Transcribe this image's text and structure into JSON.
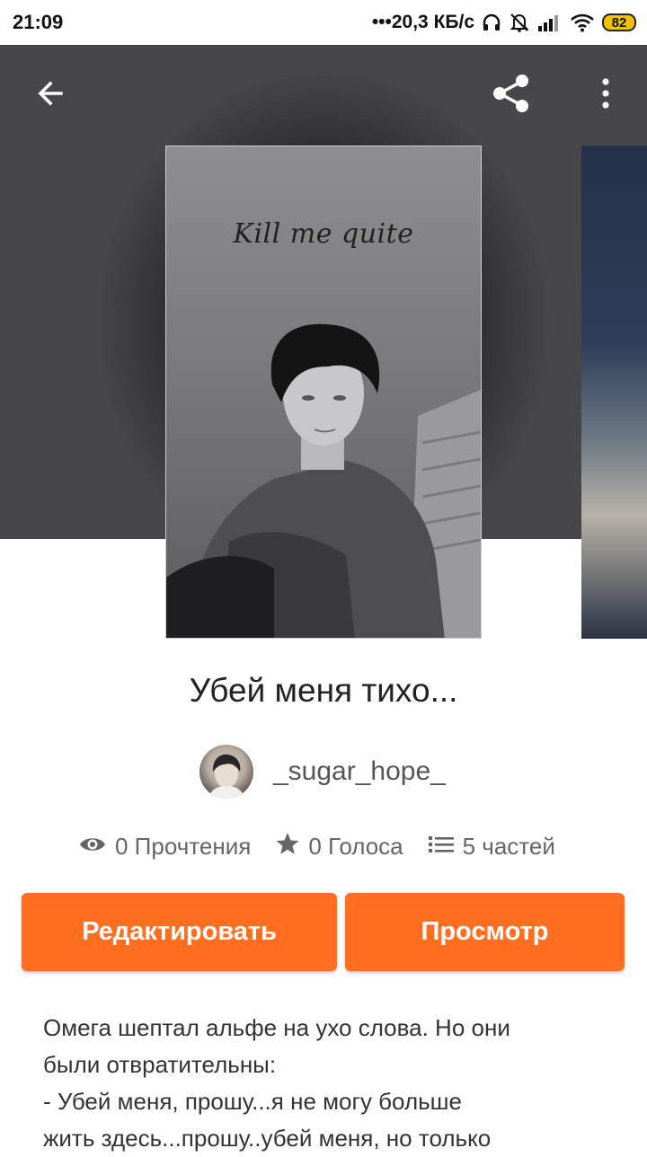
{
  "status_bar": {
    "time": "21:09",
    "network_speed": "•••20,3 КБ/с",
    "battery_level": "82",
    "icons": [
      "headphones-icon",
      "muted-bell-icon",
      "signal-icon",
      "wifi-icon",
      "battery-icon"
    ]
  },
  "top_bar": {
    "icons": [
      "back-arrow-icon",
      "share-icon",
      "more-vertical-icon"
    ]
  },
  "cover": {
    "title_text": "Kill me quite"
  },
  "book": {
    "title": "Убей меня тихо...",
    "author": "_sugar_hope_"
  },
  "stats": {
    "reads": "0 Прочтения",
    "votes": "0 Голоса",
    "parts": "5 частей"
  },
  "actions": {
    "edit_label": "Редактировать",
    "view_label": "Просмотр"
  },
  "description": "Омега шептал альфе на ухо слова. Но они\nбыли отвратительны:\n- Убей меня, прошу...я не могу больше\nжить здесь...прошу..убей меня, но только",
  "colors": {
    "accent": "#ff6f1f",
    "hero_background": "#47474a"
  }
}
